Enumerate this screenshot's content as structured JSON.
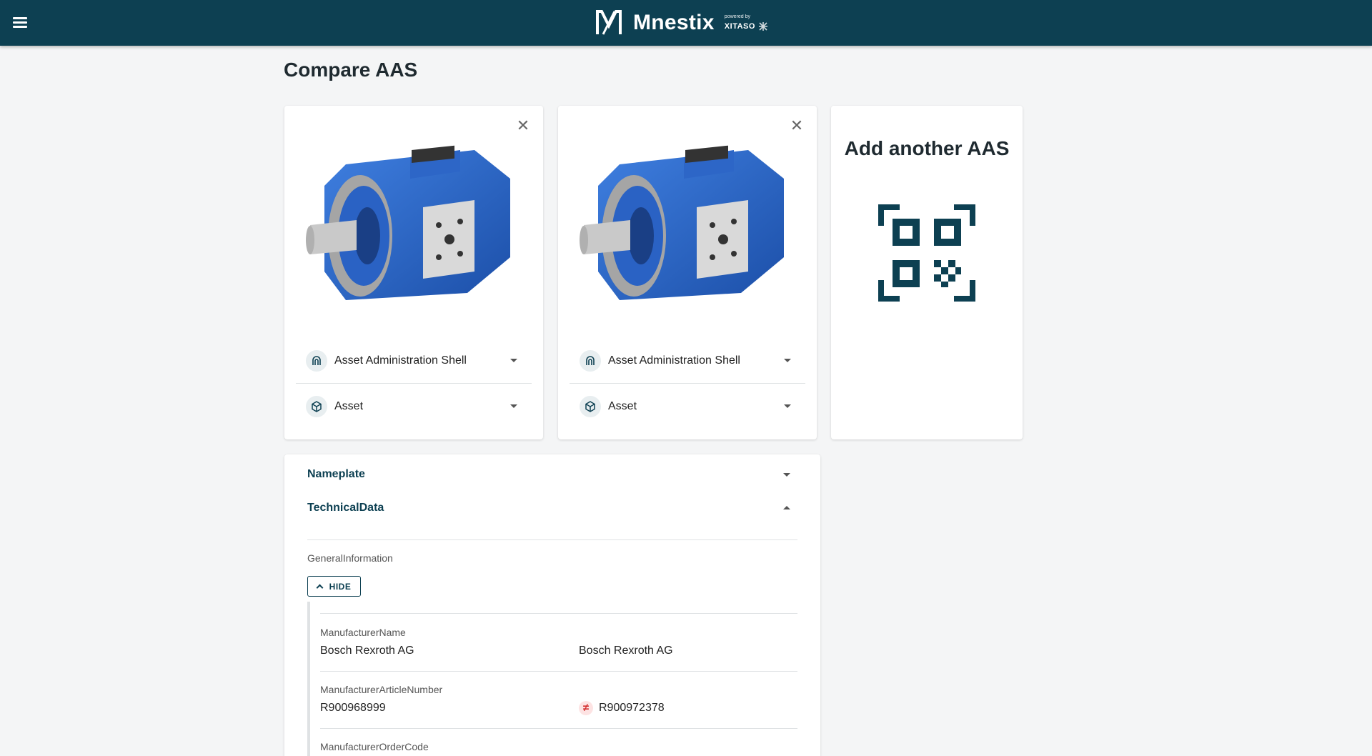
{
  "app": {
    "name": "Mnestix",
    "powered_by": "powered by",
    "powered_brand": "XITASO",
    "header_color": "#0d4052",
    "accent_color": "#0d4052",
    "diff_color": "#d32f2f"
  },
  "page": {
    "title": "Compare AAS"
  },
  "aas_cards": [
    {
      "aas_label": "Asset Administration Shell",
      "asset_label": "Asset"
    },
    {
      "aas_label": "Asset Administration Shell",
      "asset_label": "Asset"
    }
  ],
  "add_card": {
    "title": "Add another AAS",
    "icon": "qr-code-icon"
  },
  "compare": {
    "sections": [
      {
        "label": "Nameplate",
        "expanded": false
      },
      {
        "label": "TechnicalData",
        "expanded": true
      }
    ],
    "group_label": "GeneralInformation",
    "hide_label": "HIDE",
    "properties": [
      {
        "name": "ManufacturerName",
        "values": [
          "Bosch Rexroth AG",
          "Bosch Rexroth AG"
        ],
        "different": false
      },
      {
        "name": "ManufacturerArticleNumber",
        "values": [
          "R900968999",
          "R900972378"
        ],
        "different": true
      },
      {
        "name": "ManufacturerOrderCode",
        "values": [
          "",
          ""
        ],
        "different": false
      }
    ],
    "diff_symbol": "≠"
  }
}
